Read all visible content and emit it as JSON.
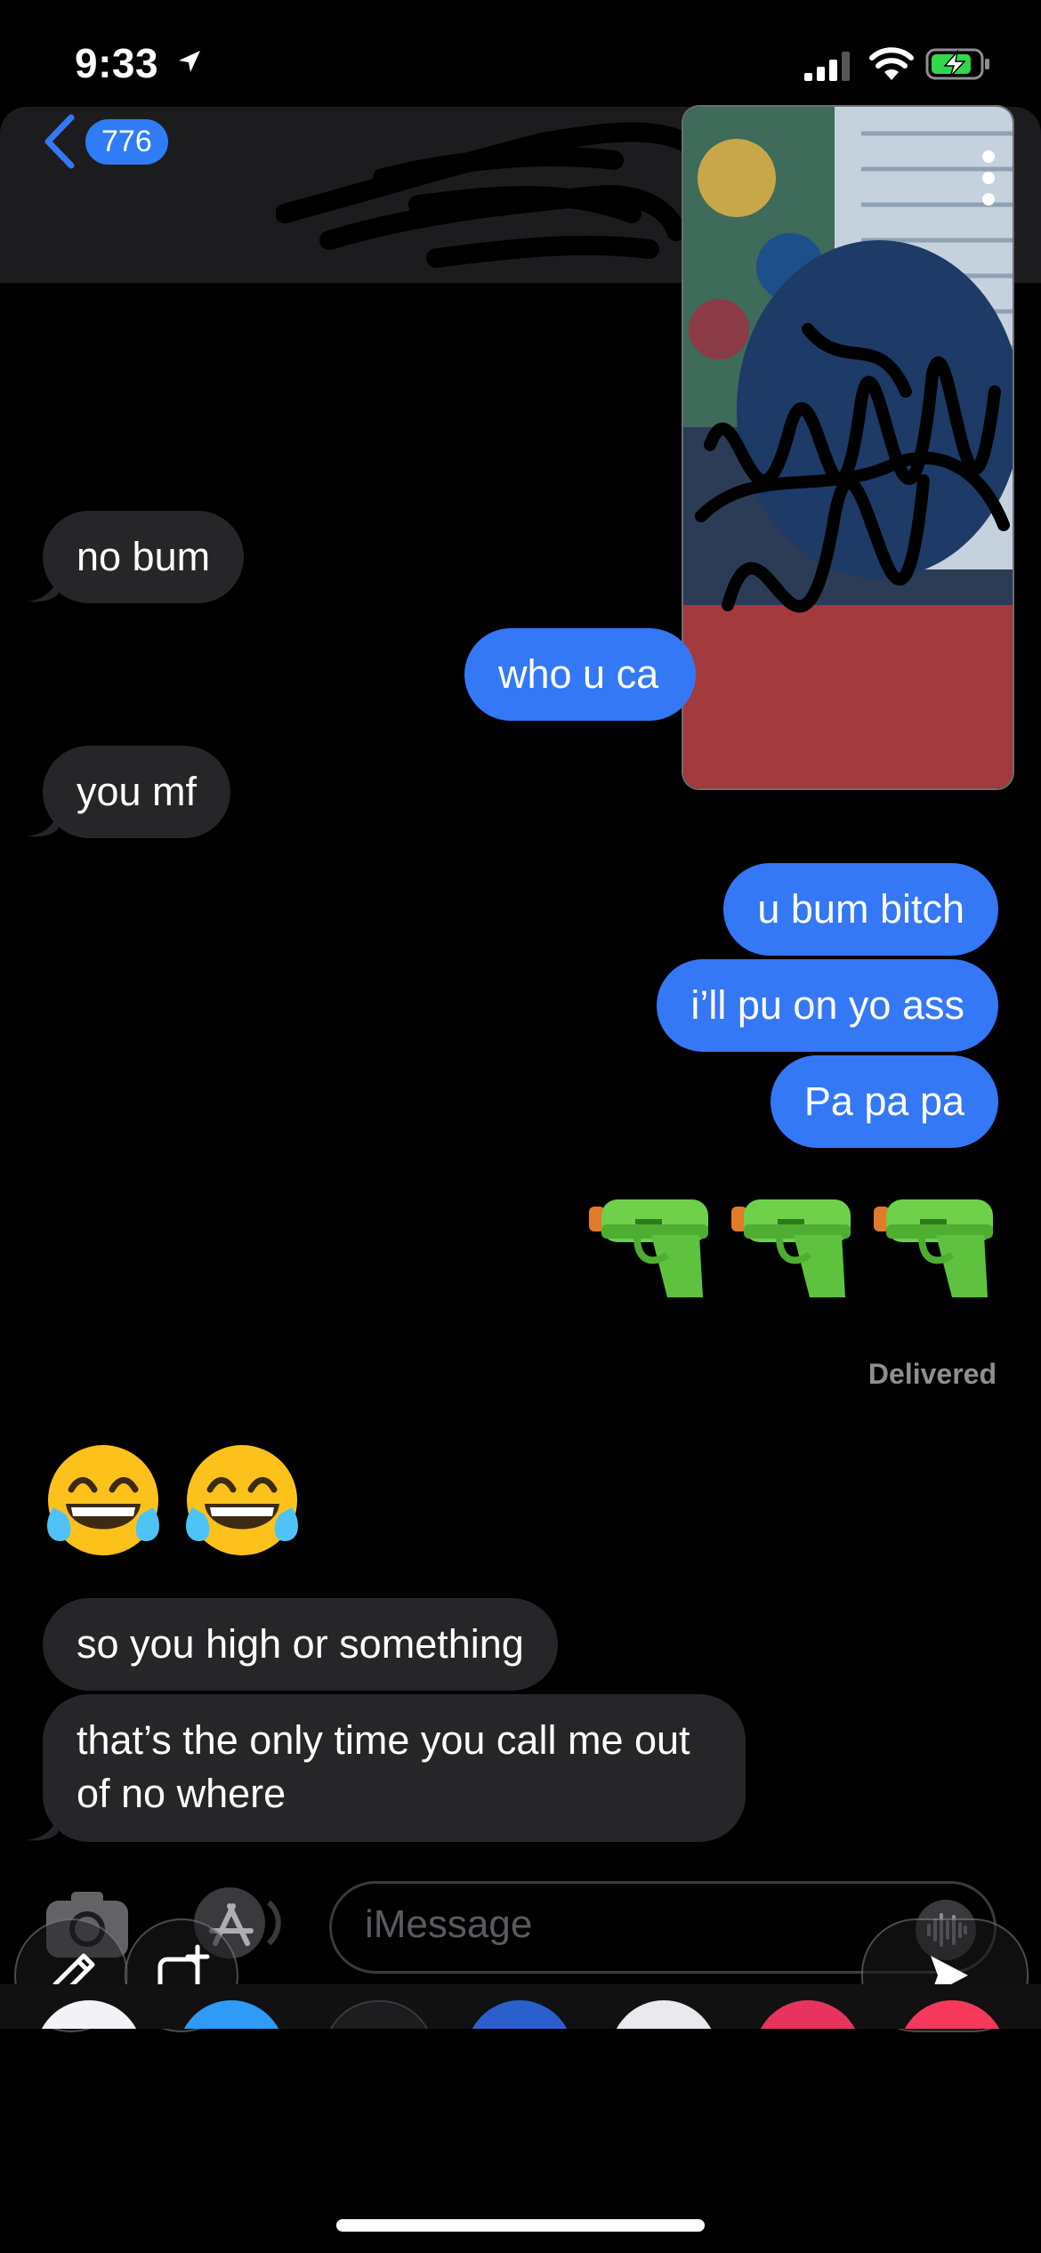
{
  "status_bar": {
    "time": "9:33",
    "icons": [
      "location-arrow-icon",
      "cellular-signal-icon",
      "wifi-icon",
      "battery-charging-icon"
    ]
  },
  "header": {
    "unread_badge": "776",
    "icons": [
      "back-chevron-icon",
      "more-vertical-icon"
    ]
  },
  "messages": [
    {
      "direction": "incoming",
      "text": "no bum"
    },
    {
      "direction": "outgoing",
      "text": "who u ca"
    },
    {
      "direction": "incoming",
      "text": "you mf"
    },
    {
      "direction": "outgoing",
      "text": "u bum bitch"
    },
    {
      "direction": "outgoing",
      "text": "i’ll pu on yo ass"
    },
    {
      "direction": "outgoing",
      "text": "Pa pa pa"
    },
    {
      "direction": "incoming",
      "text": "so you high or something"
    },
    {
      "direction": "incoming",
      "text": "that’s the only time you call me out of no where"
    }
  ],
  "emoji_messages": {
    "outgoing": [
      "water-pistol-icon",
      "water-pistol-icon",
      "water-pistol-icon"
    ],
    "incoming": [
      "tears-of-joy-icon",
      "tears-of-joy-icon"
    ]
  },
  "status": {
    "delivered": "Delivered"
  },
  "input_bar": {
    "placeholder": "iMessage",
    "icons": [
      "camera-icon",
      "app-store-icon",
      "audio-waveform-icon",
      "pencil-icon",
      "add-frame-icon",
      "send-arrow-icon"
    ]
  },
  "colors": {
    "outgoing_bubble": "#3478f6",
    "incoming_bubble": "#262629",
    "background": "#000000",
    "header": "#1c1c1e",
    "badge": "#2f7cf6"
  }
}
